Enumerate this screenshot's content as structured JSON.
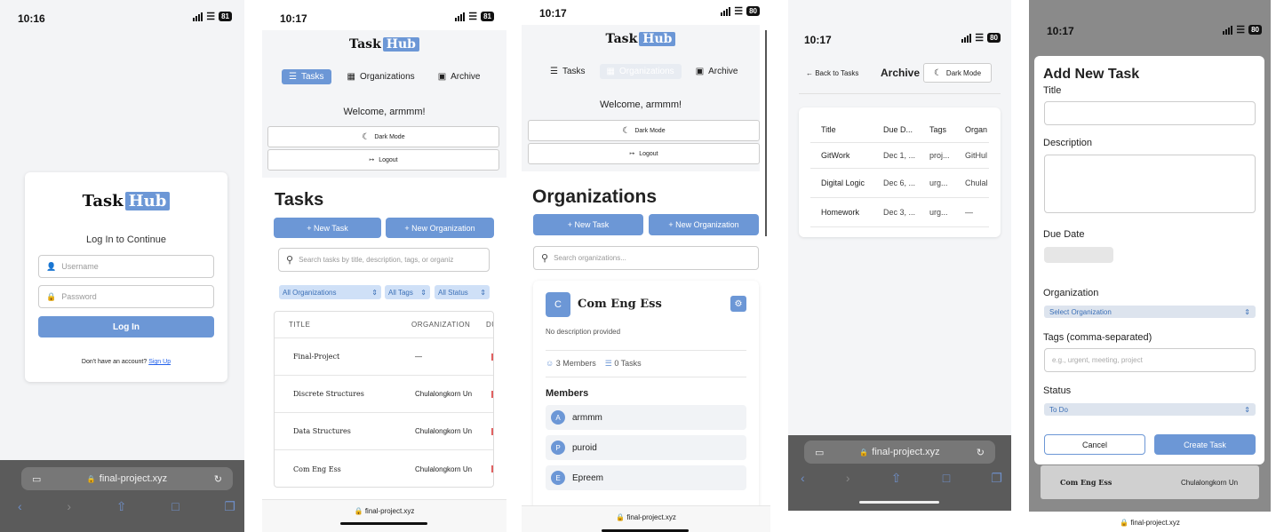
{
  "status": {
    "p1": {
      "time": "10:16",
      "battery": "81"
    },
    "p2": {
      "time": "10:17",
      "battery": "81"
    },
    "p3": {
      "time": "10:17",
      "battery": "80"
    },
    "p4": {
      "time": "10:17",
      "battery": "80"
    },
    "p5": {
      "time": "10:17",
      "battery": "80"
    }
  },
  "brand": {
    "task": "Task",
    "hub": "Hub"
  },
  "url": "final-project.xyz",
  "login": {
    "heading": "Log In to Continue",
    "username_placeholder": "Username",
    "password_placeholder": "Password",
    "login_button": "Log In",
    "signup_prompt": "Don't have an account?",
    "signup_link": "Sign Up"
  },
  "nav": {
    "tasks": "Tasks",
    "organizations": "Organizations",
    "archive": "Archive",
    "welcome": "Welcome, armmm!",
    "dark_mode": "Dark Mode",
    "logout": "Logout"
  },
  "tasks_page": {
    "title": "Tasks",
    "new_task": "+ New Task",
    "new_org": "+ New Organization",
    "search_placeholder": "Search tasks by title, description, tags, or organiz",
    "filter_orgs": "All Organizations",
    "filter_tags": "All Tags",
    "filter_status": "All Status",
    "headers": [
      "TITLE",
      "ORGANIZATION",
      "DU"
    ],
    "rows": [
      {
        "title": "Final-Project",
        "org": "—"
      },
      {
        "title": "Discrete Structures",
        "org": "Chulalongkorn Un"
      },
      {
        "title": "Data Structures",
        "org": "Chulalongkorn Un"
      },
      {
        "title": "Com Eng Ess",
        "org": "Chulalongkorn Un"
      }
    ]
  },
  "orgs_page": {
    "title": "Organizations",
    "new_task": "+ New Task",
    "new_org": "+ New Organization",
    "search_placeholder": "Search organizations...",
    "org_initial": "C",
    "org_name": "Com Eng Ess",
    "org_desc": "No description provided",
    "members_count": "3 Members",
    "tasks_count": "0 Tasks",
    "members_heading": "Members",
    "members": [
      {
        "initial": "A",
        "name": "armmm"
      },
      {
        "initial": "P",
        "name": "puroid"
      },
      {
        "initial": "E",
        "name": "Epreem"
      }
    ]
  },
  "archive_page": {
    "back": "← Back to Tasks",
    "title": "Archive",
    "dark_mode": "Dark Mode",
    "headers": [
      "Title",
      "Due D...",
      "Tags",
      "Organ"
    ],
    "rows": [
      {
        "title": "GitWork",
        "due": "Dec 1, ...",
        "tags": "proj...",
        "org": "GitHul"
      },
      {
        "title": "Digital Logic",
        "due": "Dec 6, ...",
        "tags": "urg...",
        "org": "Chulal"
      },
      {
        "title": "Homework",
        "due": "Dec 3, ...",
        "tags": "urg...",
        "org": "—"
      }
    ]
  },
  "add_task": {
    "title": "Add New Task",
    "title_label": "Title",
    "desc_label": "Description",
    "due_label": "Due Date",
    "org_label": "Organization",
    "org_select": "Select Organization",
    "tags_label": "Tags (comma-separated)",
    "tags_placeholder": "e.g., urgent, meeting, project",
    "status_label": "Status",
    "status_select": "To Do",
    "cancel": "Cancel",
    "create": "Create Task",
    "behind_row_title": "Com Eng Ess",
    "behind_row_org": "Chulalongkorn Un"
  },
  "colors": {
    "accent": "#6c97d6",
    "urlbar": "#5b5b5b",
    "page_bg": "#f4f5f7"
  }
}
